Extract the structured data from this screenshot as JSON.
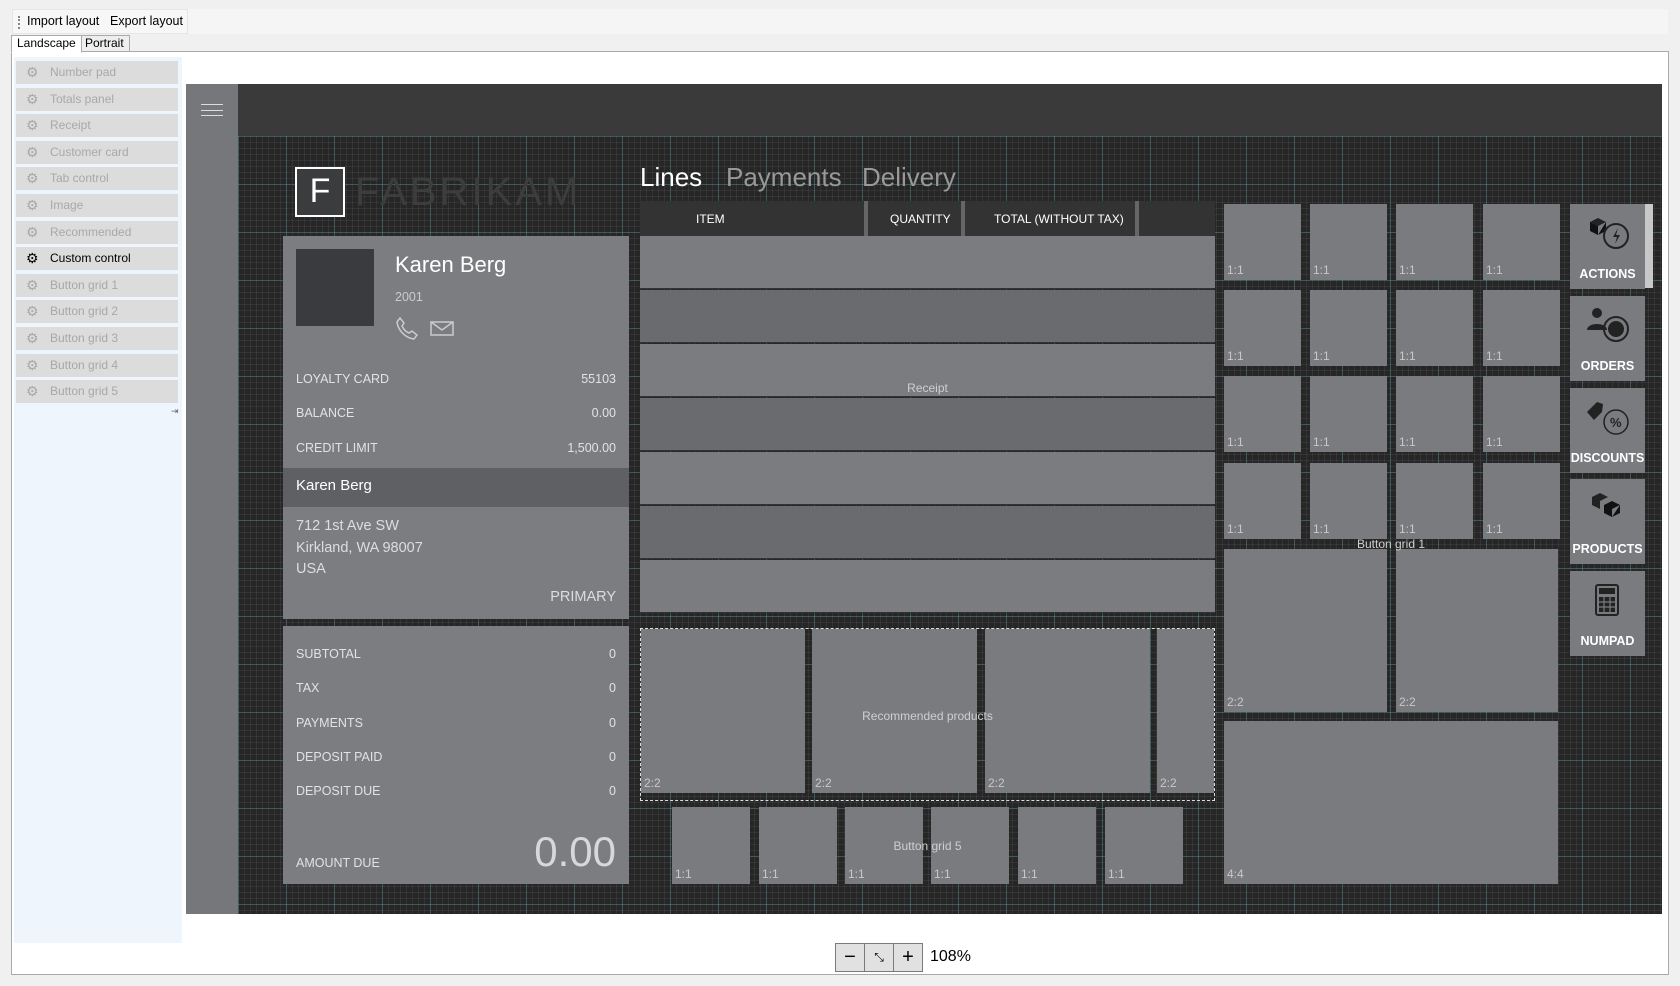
{
  "toolbar": {
    "import": "Import layout",
    "export": "Export layout"
  },
  "tabs": {
    "landscape": "Landscape",
    "portrait": "Portrait"
  },
  "palette": [
    "Number pad",
    "Totals panel",
    "Receipt",
    "Customer card",
    "Tab control",
    "Image",
    "Recommended products",
    "Custom control",
    "Button grid 1",
    "Button grid 2",
    "Button grid 3",
    "Button grid 4",
    "Button grid 5"
  ],
  "palette_selected": "Custom control",
  "logo": {
    "letter": "F",
    "name": "FABRIKAM"
  },
  "pos_tabs": [
    "Lines",
    "Payments",
    "Delivery"
  ],
  "customer": {
    "name": "Karen Berg",
    "id": "2001",
    "loyalty_label": "LOYALTY CARD",
    "loyalty": "55103",
    "balance_label": "BALANCE",
    "balance": "0.00",
    "credit_label": "CREDIT LIMIT",
    "credit": "1,500.00",
    "address_name": "Karen Berg",
    "address": [
      "712 1st Ave SW",
      "Kirkland, WA 98007",
      "USA"
    ],
    "primary": "PRIMARY"
  },
  "totals": {
    "rows": [
      {
        "label": "SUBTOTAL",
        "value": "0"
      },
      {
        "label": "TAX",
        "value": "0"
      },
      {
        "label": "PAYMENTS",
        "value": "0"
      },
      {
        "label": "DEPOSIT PAID",
        "value": "0"
      },
      {
        "label": "DEPOSIT DUE",
        "value": "0"
      }
    ],
    "amount_due_label": "AMOUNT DUE",
    "amount_due": "0.00"
  },
  "receipt": {
    "columns": [
      "ITEM",
      "QUANTITY",
      "TOTAL (WITHOUT TAX)"
    ],
    "label": "Receipt"
  },
  "recommended": {
    "label": "Recommended products",
    "tile": "2:2"
  },
  "button_grid_5": {
    "label": "Button grid 5",
    "tile": "1:1"
  },
  "button_grid_1": {
    "label": "Button grid 1",
    "small": "1:1",
    "medium": "2:2",
    "large": "4:4"
  },
  "side_buttons": [
    "ACTIONS",
    "ORDERS",
    "DISCOUNTS",
    "PRODUCTS",
    "NUMPAD"
  ],
  "zoom": {
    "level": "108%",
    "minus": "−",
    "plus": "+"
  },
  "colors": {
    "canvas": "#2a2a2a",
    "tile": "#7a7b7f",
    "panel": "#7c7d81"
  }
}
